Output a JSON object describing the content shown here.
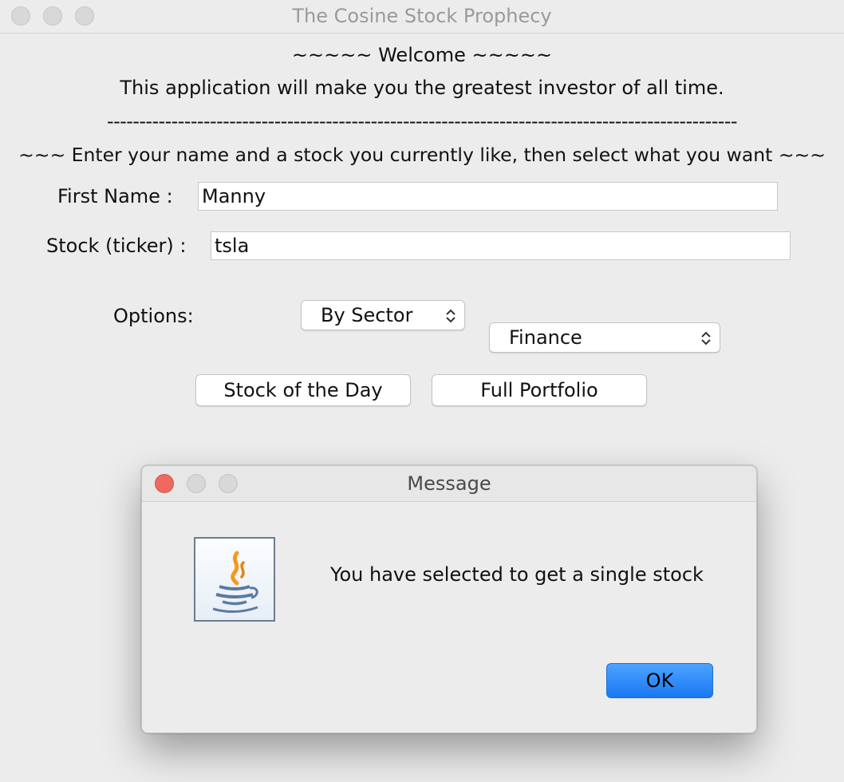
{
  "window": {
    "title": "The Cosine Stock Prophecy"
  },
  "header": {
    "welcome": "~~~~~ Welcome ~~~~~",
    "tagline": "This application will make you the greatest investor of all time.",
    "divider": "--------------------------------------------------------------------------------------------------",
    "instructions": "~~~ Enter your name and a stock you currently like, then select what you want ~~~"
  },
  "form": {
    "first_name_label": "First Name :",
    "first_name_value": "Manny",
    "stock_label": "Stock (ticker) :",
    "stock_value": "tsla",
    "options_label": "Options:",
    "option_select": "By Sector",
    "sector_select": "Finance"
  },
  "buttons": {
    "stock_of_day": "Stock of the Day",
    "full_portfolio": "Full Portfolio"
  },
  "dialog": {
    "title": "Message",
    "message": "You have selected to get a single stock",
    "ok": "OK",
    "icon": "java-coffee-cup-icon"
  },
  "colors": {
    "close_red": "#ec6a5e",
    "ok_blue": "#1a78f2",
    "window_bg": "#ececec"
  }
}
